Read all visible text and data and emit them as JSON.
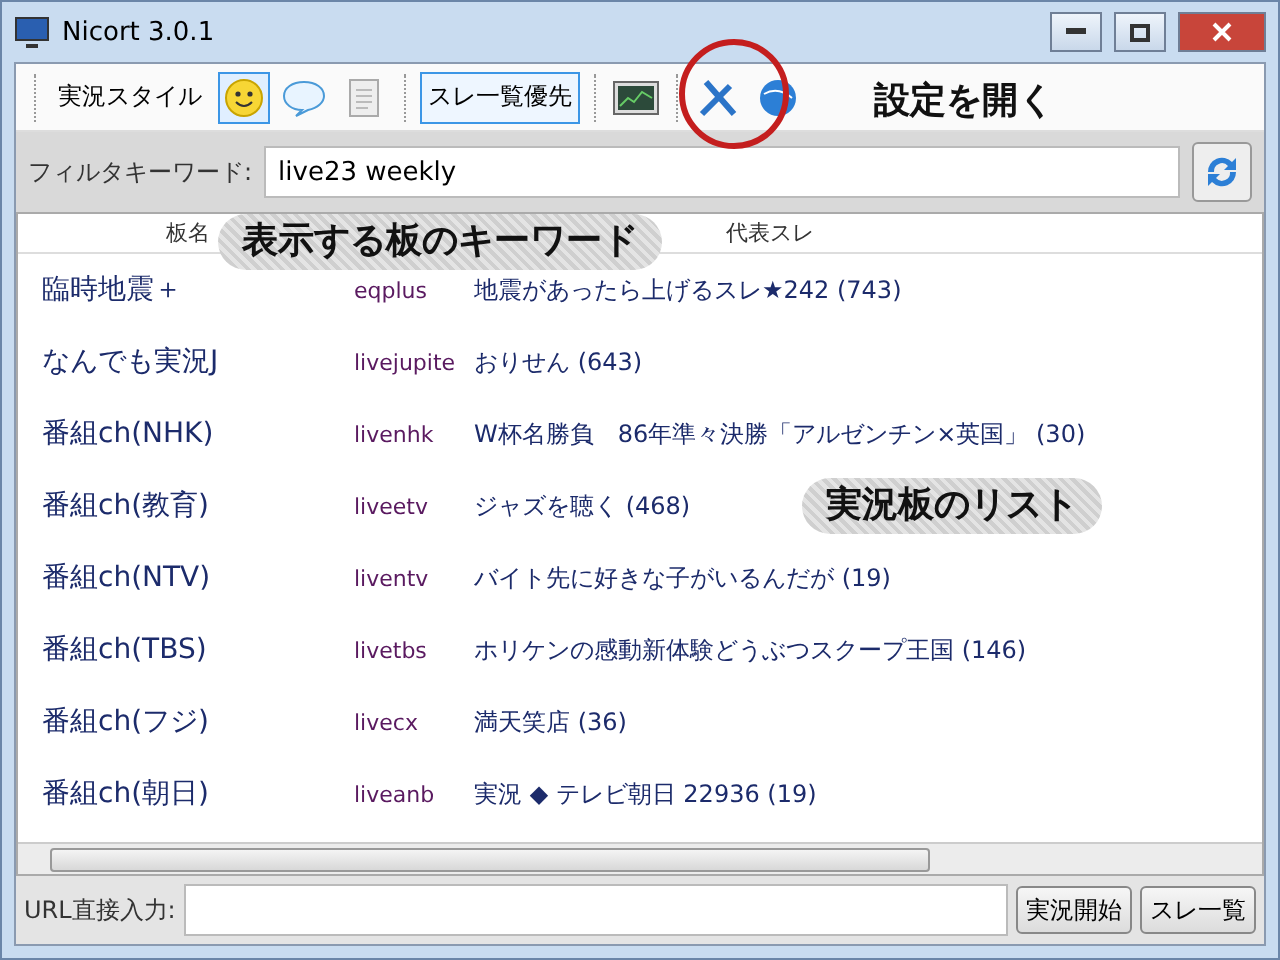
{
  "window": {
    "title": "Nicort 3.0.1"
  },
  "toolbar": {
    "style_label": "実況スタイル",
    "style_buttons": [
      {
        "kind": "smiley",
        "selected": true
      },
      {
        "kind": "balloon",
        "selected": false
      },
      {
        "kind": "document",
        "selected": false
      }
    ],
    "thread_priority": {
      "label": "スレ一覧優先",
      "selected": true
    }
  },
  "filter": {
    "label": "フィルタキーワード:",
    "value": "live23 weekly"
  },
  "table": {
    "columns": [
      "板名",
      "代表スレ"
    ],
    "rows": [
      {
        "board": "臨時地震＋",
        "id": "eqplus",
        "thread": "地震があったら上げるスレ★242 (743)"
      },
      {
        "board": "なんでも実況J",
        "id": "livejupite",
        "thread": "おりせん (643)"
      },
      {
        "board": "番組ch(NHK)",
        "id": "livenhk",
        "thread": "W杯名勝負　86年準々決勝「アルゼンチン×英国」 (30)"
      },
      {
        "board": "番組ch(教育)",
        "id": "liveetv",
        "thread": "ジャズを聴く (468)"
      },
      {
        "board": "番組ch(NTV)",
        "id": "liventv",
        "thread": "バイト先に好きな子がいるんだが (19)"
      },
      {
        "board": "番組ch(TBS)",
        "id": "livetbs",
        "thread": "ホリケンの感動新体験どうぶつスクープ王国 (146)"
      },
      {
        "board": "番組ch(フジ)",
        "id": "livecx",
        "thread": "満天笑店 (36)"
      },
      {
        "board": "番組ch(朝日)",
        "id": "liveanb",
        "thread": "実況 ◆ テレビ朝日 22936 (19)"
      }
    ]
  },
  "url_bar": {
    "label": "URL直接入力:",
    "buttons": [
      "実況開始",
      "スレ一覧"
    ]
  },
  "annotations": [
    {
      "kind": "settings",
      "text": "設定を開く"
    },
    {
      "kind": "keyword",
      "text": "表示する板のキーワード"
    },
    {
      "kind": "list",
      "text": "実況板のリスト"
    }
  ]
}
